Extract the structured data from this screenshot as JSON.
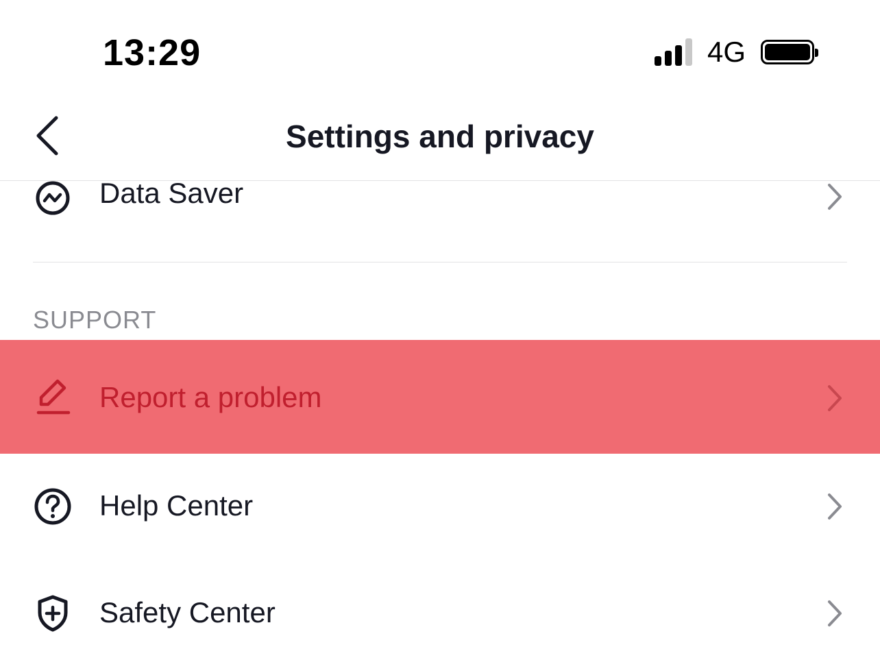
{
  "status_bar": {
    "time": "13:29",
    "network": "4G",
    "signal_bars_active": 3,
    "signal_bars_total": 4,
    "battery_level": 1.0
  },
  "nav": {
    "title": "Settings and privacy",
    "back_icon": "chevron-left-icon"
  },
  "rows": {
    "data_saver": {
      "label": "Data Saver",
      "icon": "data-saver-icon"
    },
    "report_problem": {
      "label": "Report a problem",
      "icon": "pencil-icon",
      "highlighted": true,
      "highlight_color": "#f06b72",
      "text_color": "#c01f2e"
    },
    "help_center": {
      "label": "Help Center",
      "icon": "question-circle-icon"
    },
    "safety_center": {
      "label": "Safety Center",
      "icon": "shield-plus-icon"
    }
  },
  "sections": {
    "support": {
      "header": "SUPPORT"
    }
  },
  "colors": {
    "text_primary": "#161823",
    "text_secondary": "#8a8b91",
    "chevron": "#8a8b91",
    "divider": "#e3e3e4"
  }
}
